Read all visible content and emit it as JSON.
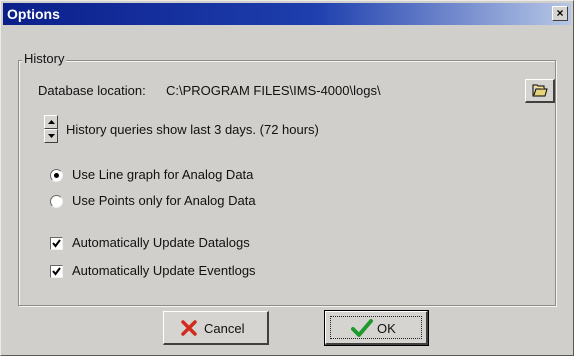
{
  "window": {
    "title": "Options",
    "close_label": "×"
  },
  "history": {
    "group_label": "History",
    "database_location_label": "Database location:",
    "database_location_value": "C:\\PROGRAM FILES\\IMS-4000\\logs\\",
    "browse_icon": "folder-open-icon",
    "query_days_text": "History queries show last 3 days. (72 hours)",
    "query_days": 3,
    "graph_mode": {
      "selected": "line",
      "options": [
        {
          "id": "line",
          "label": "Use Line graph for Analog Data"
        },
        {
          "id": "points",
          "label": "Use Points only for Analog Data"
        }
      ]
    },
    "auto_update": [
      {
        "label": "Automatically Update Datalogs",
        "checked": true
      },
      {
        "label": "Automatically Update Eventlogs",
        "checked": true
      }
    ]
  },
  "buttons": {
    "cancel_label": "Cancel",
    "cancel_icon": "red-x-icon",
    "ok_label": "OK",
    "ok_icon": "green-checkmark-icon"
  },
  "colors": {
    "title_bar_start": "#0b1f8a",
    "title_bar_end": "#b7c7e6",
    "dialog_face": "#d0cfcb",
    "cancel_icon": "#d12a1e",
    "ok_icon": "#1f9a2e"
  }
}
